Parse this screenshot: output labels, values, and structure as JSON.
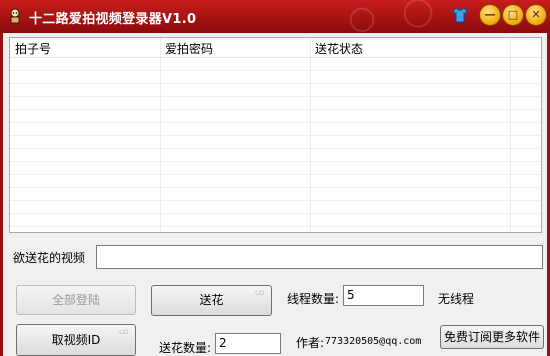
{
  "window": {
    "title": "十二路爱拍视频登录器V1.0",
    "accent_color": "#b31515"
  },
  "table": {
    "columns": [
      "拍子号",
      "爱拍密码",
      "送花状态"
    ],
    "rows": []
  },
  "video_field": {
    "label": "欲送花的视频",
    "value": ""
  },
  "buttons": {
    "login_all": "全部登陆",
    "send_flower": "送花",
    "get_video_id": "取视频ID",
    "subscribe": "免费订阅更多软件"
  },
  "thread": {
    "label": "线程数量:",
    "value": "5",
    "status": "无线程"
  },
  "flower": {
    "label": "送花数量:",
    "value": "2"
  },
  "author": {
    "label": "作者:",
    "email": "773320505@qq.com"
  }
}
